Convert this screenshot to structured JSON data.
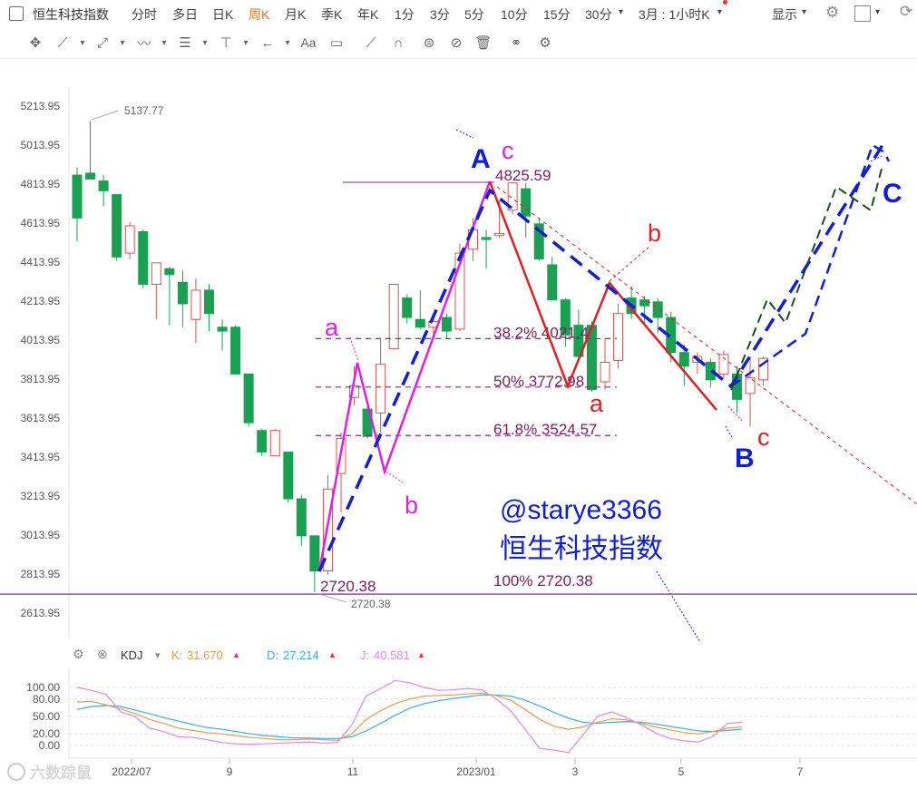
{
  "topbar": {
    "title": "恒生科技指数",
    "periods": [
      "分时",
      "多日",
      "日K",
      "周K",
      "月K",
      "季K",
      "年K",
      "1分",
      "3分",
      "5分",
      "10分",
      "15分",
      "30分"
    ],
    "active_period": "周K",
    "range_select": "3月 : 1小时K",
    "display_label": "显示"
  },
  "toolbar": {
    "icons": [
      "crosshair-icon",
      "line-icon",
      "ray-icon",
      "wave-icon",
      "channel-icon",
      "price-line-icon",
      "arrow-icon",
      "text-icon",
      "comment-icon",
      "ruler-icon",
      "magnet-icon",
      "lock-icon",
      "eye-off-icon",
      "trash-icon",
      "link-icon",
      "settings-icon"
    ],
    "text_icon_label": "Aa"
  },
  "chart_data": {
    "type": "candlestick",
    "title": "恒生科技指数",
    "period": "weekly",
    "y_ticks": [
      "5213.95",
      "5013.95",
      "4813.95",
      "4613.95",
      "4413.95",
      "4213.95",
      "4013.95",
      "3813.95",
      "3613.95",
      "3413.95",
      "3213.95",
      "3013.95",
      "2813.95",
      "2613.95"
    ],
    "ylim": [
      2540,
      5320
    ],
    "x_ticks": [
      "2022/07",
      "9",
      "11",
      "2023/01",
      "3",
      "5",
      "7"
    ],
    "candles": [
      {
        "o": 4860,
        "h": 4900,
        "l": 4520,
        "c": 4640
      },
      {
        "o": 4870,
        "h": 5137.77,
        "l": 4860,
        "c": 4840
      },
      {
        "o": 4830,
        "h": 4860,
        "l": 4700,
        "c": 4780
      },
      {
        "o": 4760,
        "h": 4760,
        "l": 4420,
        "c": 4440
      },
      {
        "o": 4460,
        "h": 4620,
        "l": 4430,
        "c": 4600
      },
      {
        "o": 4570,
        "h": 4580,
        "l": 4280,
        "c": 4300
      },
      {
        "o": 4300,
        "h": 4400,
        "l": 4120,
        "c": 4410
      },
      {
        "o": 4380,
        "h": 4390,
        "l": 4090,
        "c": 4350
      },
      {
        "o": 4310,
        "h": 4370,
        "l": 4080,
        "c": 4200
      },
      {
        "o": 4120,
        "h": 4330,
        "l": 4000,
        "c": 4270
      },
      {
        "o": 4270,
        "h": 4300,
        "l": 4060,
        "c": 4150
      },
      {
        "o": 4080,
        "h": 4120,
        "l": 3960,
        "c": 4060
      },
      {
        "o": 4080,
        "h": 4090,
        "l": 3840,
        "c": 3840
      },
      {
        "o": 3840,
        "h": 3840,
        "l": 3570,
        "c": 3590
      },
      {
        "o": 3550,
        "h": 3560,
        "l": 3420,
        "c": 3440
      },
      {
        "o": 3420,
        "h": 3560,
        "l": 3420,
        "c": 3550
      },
      {
        "o": 3440,
        "h": 3440,
        "l": 3180,
        "c": 3200
      },
      {
        "o": 3200,
        "h": 3220,
        "l": 2960,
        "c": 3010
      },
      {
        "o": 3010,
        "h": 3010,
        "l": 2720.38,
        "c": 2830
      },
      {
        "o": 2830,
        "h": 3320,
        "l": 2810,
        "c": 3250
      },
      {
        "o": 3330,
        "h": 3540,
        "l": 3130,
        "c": 3510
      },
      {
        "o": 3720,
        "h": 3880,
        "l": 3680,
        "c": 3780
      },
      {
        "o": 3660,
        "h": 3680,
        "l": 3510,
        "c": 3520
      },
      {
        "o": 3640,
        "h": 4020,
        "l": 3540,
        "c": 3890
      },
      {
        "o": 3970,
        "h": 4300,
        "l": 3970,
        "c": 4300
      },
      {
        "o": 4230,
        "h": 4250,
        "l": 4100,
        "c": 4130
      },
      {
        "o": 4120,
        "h": 4270,
        "l": 4070,
        "c": 4080
      },
      {
        "o": 4080,
        "h": 4130,
        "l": 4020,
        "c": 4110
      },
      {
        "o": 4130,
        "h": 4150,
        "l": 4020,
        "c": 4060
      },
      {
        "o": 4070,
        "h": 4510,
        "l": 4060,
        "c": 4460
      },
      {
        "o": 4480,
        "h": 4640,
        "l": 4420,
        "c": 4580
      },
      {
        "o": 4540,
        "h": 4580,
        "l": 4380,
        "c": 4530
      },
      {
        "o": 4550,
        "h": 4730,
        "l": 4540,
        "c": 4560
      },
      {
        "o": 4680,
        "h": 4825.59,
        "l": 4660,
        "c": 4820
      },
      {
        "o": 4790,
        "h": 4820,
        "l": 4540,
        "c": 4650
      },
      {
        "o": 4610,
        "h": 4640,
        "l": 4420,
        "c": 4430
      },
      {
        "o": 4400,
        "h": 4440,
        "l": 4220,
        "c": 4220
      },
      {
        "o": 4220,
        "h": 4230,
        "l": 3980,
        "c": 4040
      },
      {
        "o": 4090,
        "h": 4170,
        "l": 3900,
        "c": 3930
      },
      {
        "o": 4090,
        "h": 4110,
        "l": 3750,
        "c": 3760
      },
      {
        "o": 3800,
        "h": 4020,
        "l": 3760,
        "c": 3900
      },
      {
        "o": 3910,
        "h": 4200,
        "l": 3870,
        "c": 4150
      },
      {
        "o": 4230,
        "h": 4290,
        "l": 4120,
        "c": 4150
      },
      {
        "o": 4220,
        "h": 4240,
        "l": 4090,
        "c": 4190
      },
      {
        "o": 4210,
        "h": 4230,
        "l": 4050,
        "c": 4130
      },
      {
        "o": 4130,
        "h": 4160,
        "l": 3900,
        "c": 3950
      },
      {
        "o": 3950,
        "h": 3990,
        "l": 3780,
        "c": 3880
      },
      {
        "o": 3900,
        "h": 3950,
        "l": 3840,
        "c": 3930
      },
      {
        "o": 3900,
        "h": 3920,
        "l": 3770,
        "c": 3810
      },
      {
        "o": 3840,
        "h": 3960,
        "l": 3820,
        "c": 3940
      },
      {
        "o": 3840,
        "h": 3880,
        "l": 3640,
        "c": 3710
      },
      {
        "o": 3740,
        "h": 3930,
        "l": 3570,
        "c": 3820
      },
      {
        "o": 3810,
        "h": 3930,
        "l": 3780,
        "c": 3920
      }
    ],
    "price_labels": {
      "high": "5137.77",
      "peak": "4825.59",
      "low": "2720.38",
      "low_axis": "2720.38"
    },
    "fib_levels": [
      {
        "label": "38.2% 4021.4",
        "value": 4021.4
      },
      {
        "label": "50% 3772.98",
        "value": 3772.98
      },
      {
        "label": "61.8% 3524.57",
        "value": 3524.57
      },
      {
        "label": "100% 2720.38",
        "value": 2720.38
      }
    ],
    "annotations": {
      "A": "A",
      "B": "B",
      "C": "C",
      "a1": "a",
      "b1": "b",
      "c1": "c",
      "a2": "a",
      "b2": "b",
      "c2": "c"
    },
    "watermark_user": "@starye3366",
    "watermark_name": "恒生科技指数",
    "colors": {
      "up": "#d9534f",
      "down": "#1aa052",
      "wave_magenta": "#e020e0",
      "wave_red": "#e02020",
      "wave_blue": "#1020d0",
      "wave_green": "#1a4d1a",
      "fib": "#8a2a8a",
      "label_purple": "#7a1c5e"
    }
  },
  "kdj": {
    "name": "KDJ",
    "k_label": "K:",
    "k_value": "31.670",
    "d_label": "D:",
    "d_value": "27.214",
    "j_label": "J:",
    "j_value": "40.581",
    "y_ticks": [
      "100.00",
      "80.00",
      "50.00",
      "20.00",
      "0.00"
    ],
    "k_series": [
      75,
      76,
      70,
      63,
      55,
      45,
      38,
      30,
      26,
      22,
      20,
      17,
      14,
      12,
      10,
      10,
      11,
      10,
      9,
      20,
      45,
      60,
      72,
      80,
      85,
      86,
      87,
      89,
      90,
      86,
      78,
      62,
      45,
      33,
      28,
      32,
      40,
      46,
      44,
      38,
      32,
      27,
      22,
      20,
      24,
      30,
      32
    ],
    "d_series": [
      62,
      67,
      69,
      67,
      61,
      55,
      48,
      42,
      36,
      31,
      28,
      24,
      20,
      17,
      15,
      13,
      13,
      12,
      12,
      15,
      25,
      38,
      52,
      64,
      72,
      77,
      81,
      84,
      87,
      87,
      85,
      78,
      68,
      57,
      47,
      40,
      38,
      40,
      41,
      40,
      37,
      33,
      29,
      25,
      24,
      26,
      28
    ],
    "j_series": [
      100,
      95,
      88,
      58,
      50,
      30,
      24,
      15,
      14,
      10,
      5,
      3,
      2,
      3,
      4,
      5,
      6,
      4,
      5,
      35,
      85,
      98,
      112,
      108,
      100,
      95,
      96,
      98,
      96,
      80,
      60,
      28,
      -5,
      -8,
      -12,
      18,
      50,
      58,
      48,
      36,
      22,
      12,
      8,
      6,
      16,
      38,
      40
    ],
    "colors": {
      "k": "#e89b4c",
      "d": "#3ab0d6",
      "j": "#e08ae0"
    }
  },
  "watermark_logo": "六数踪鼠"
}
